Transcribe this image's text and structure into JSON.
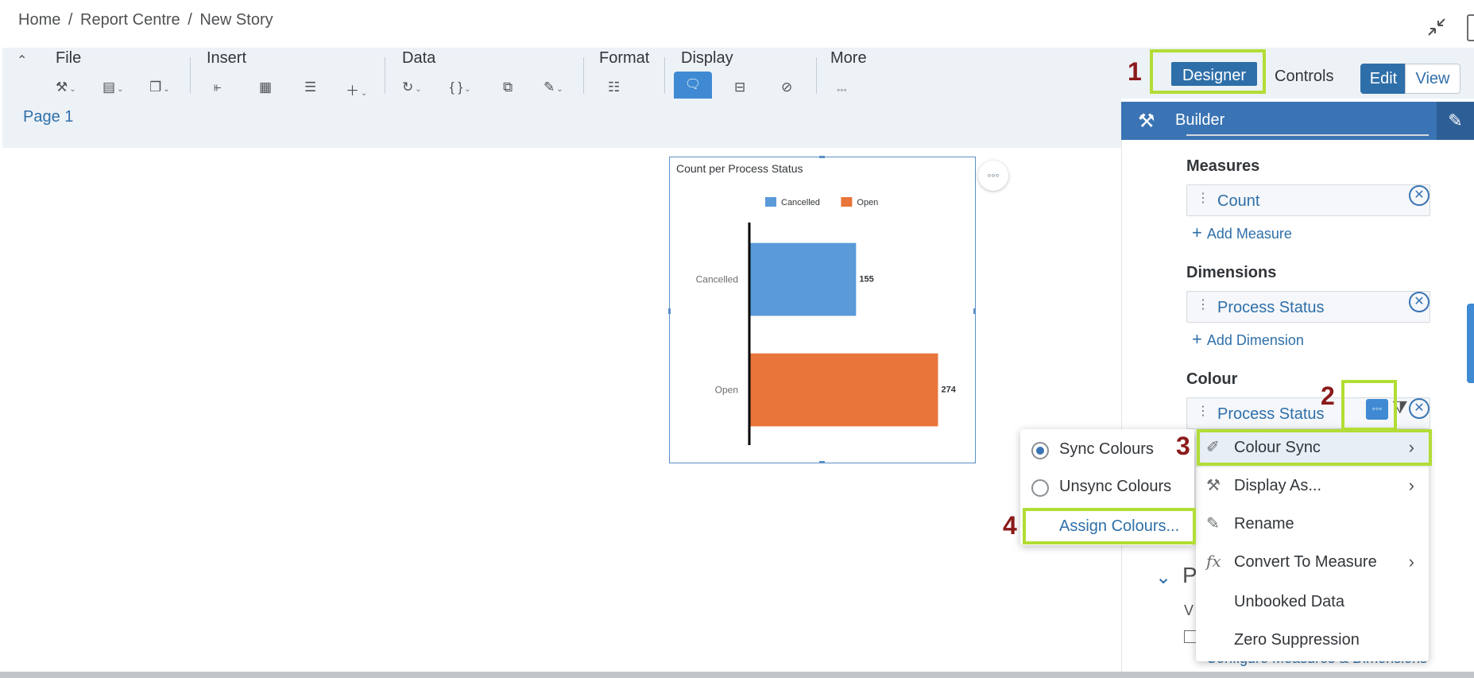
{
  "breadcrumb": {
    "home": "Home",
    "sep1": "/",
    "report_centre": "Report Centre",
    "sep2": "/",
    "current": "New Story"
  },
  "toolbar": {
    "groups": {
      "file": "File",
      "insert": "Insert",
      "data": "Data",
      "format": "Format",
      "display": "Display",
      "more": "More"
    },
    "icons": {
      "tools": "wrench-icon",
      "save": "save-icon",
      "copy": "copy-icon",
      "chart": "chart-icon",
      "table": "table-icon",
      "input_control": "sliders-icon",
      "add": "plus-icon",
      "refresh": "refresh-icon",
      "formula": "braces-icon",
      "linked": "link-dims-icon",
      "edit_data": "edit-icon",
      "format_panel": "format-icon",
      "comment": "comment-icon",
      "layout": "layout-icon",
      "explorer": "compass-icon",
      "more": "more-icon"
    },
    "more_glyph": "◦◦◦"
  },
  "view_controls": {
    "designer": "Designer",
    "controls": "Controls",
    "edit": "Edit",
    "view": "View"
  },
  "page": {
    "tab": "Page 1"
  },
  "chart_data": {
    "type": "bar",
    "orientation": "horizontal",
    "title": "Count per Process Status",
    "categories": [
      "Cancelled",
      "Open"
    ],
    "series": [
      {
        "name": "Count",
        "values": [
          155,
          274
        ],
        "colors": [
          "#5a9ad9",
          "#e8753a"
        ]
      }
    ],
    "legend": {
      "placement": "top",
      "entries": [
        {
          "label": "Cancelled",
          "color": "#5a9ad9"
        },
        {
          "label": "Open",
          "color": "#e8753a"
        }
      ]
    },
    "data_labels": [
      "155",
      "274"
    ],
    "xlim": [
      0,
      300
    ],
    "grid": false
  },
  "builder": {
    "title": "Builder",
    "measures": {
      "title": "Measures",
      "item": "Count",
      "add": "Add Measure"
    },
    "dimensions": {
      "title": "Dimensions",
      "item": "Process Status",
      "add": "Add Dimension"
    },
    "colour": {
      "title": "Colour",
      "item": "Process Status"
    },
    "behind": {
      "section_letter": "P",
      "v_letter": "V",
      "link_text": "Configure Measures & Dimensions"
    }
  },
  "context_menu": {
    "items": [
      {
        "label": "Colour Sync",
        "icon": "paint-icon",
        "submenu": true
      },
      {
        "label": "Display As...",
        "icon": "wrench-icon",
        "submenu": true
      },
      {
        "label": "Rename",
        "icon": "pencil-icon",
        "submenu": false
      },
      {
        "label": "Convert To Measure",
        "icon": "fx-icon",
        "submenu": true
      },
      {
        "label": "Unbooked Data",
        "icon": "",
        "submenu": false
      },
      {
        "label": "Zero Suppression",
        "icon": "",
        "submenu": false
      }
    ]
  },
  "submenu": {
    "sync": "Sync Colours",
    "unsync": "Unsync Colours",
    "assign": "Assign Colours...",
    "selected": "sync"
  },
  "annotations": {
    "step1": "1",
    "step2": "2",
    "step3": "3",
    "step4": "4",
    "highlight_color": "#b2dd35",
    "number_color": "#8b1a1a"
  }
}
